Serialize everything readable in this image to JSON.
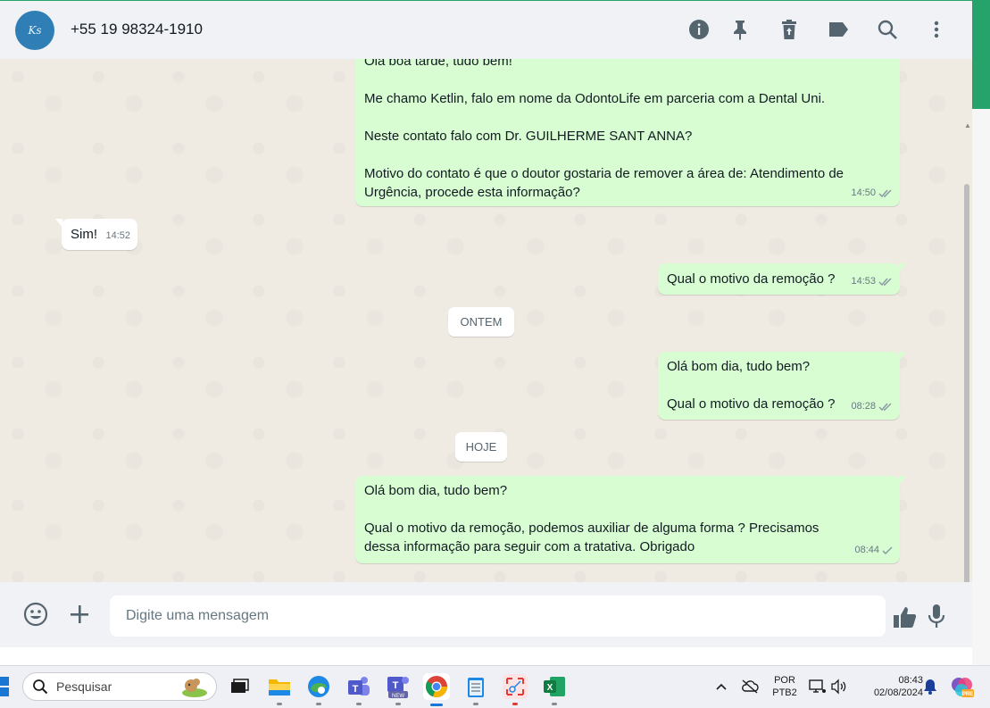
{
  "header": {
    "contact_name": "+55 19 98324-1910",
    "avatar_initials": "Ks",
    "icons": [
      "info-icon",
      "pin-icon",
      "delete-icon",
      "label-icon",
      "search-icon",
      "menu-icon"
    ]
  },
  "messages": [
    {
      "dir": "out",
      "text": "Olá boa tarde, tudo bem!\n\nMe chamo Ketlin, falo em nome da OdontoLife em parceria com a Dental Uni.\n\nNeste contato falo com Dr. GUILHERME SANT ANNA?\n\nMotivo do contato é que o doutor gostaria de remover a área de: Atendimento de Urgência, procede esta informação?",
      "time": "14:50",
      "status": "read"
    },
    {
      "dir": "in",
      "text": "Sim!",
      "time": "14:52"
    },
    {
      "dir": "out",
      "text": "Qual o motivo da remoção ?",
      "time": "14:53",
      "status": "read"
    },
    {
      "dir": "out",
      "text": "Olá bom dia, tudo bem?\n\nQual o motivo da remoção ?",
      "time": "08:28",
      "status": "read"
    },
    {
      "dir": "out",
      "text": "Olá bom dia, tudo bem?\n\nQual o motivo da remoção, podemos auxiliar de alguma forma ? Precisamos dessa informação para seguir com a tratativa. Obrigado",
      "time": "08:44",
      "status": "sent"
    }
  ],
  "dividers": {
    "yesterday": "ONTEM",
    "today": "HOJE"
  },
  "composer": {
    "placeholder": "Digite uma mensagem"
  },
  "taskbar": {
    "search_placeholder": "Pesquisar",
    "language": "POR",
    "layout": "PTB2",
    "time": "08:43",
    "date": "02/08/2024",
    "copilot_badge": "PRE",
    "teams_badge": "NEW"
  },
  "colors": {
    "outgoing_bubble": "#d9fdd3",
    "incoming_bubble": "#ffffff",
    "chat_background": "#efeae2",
    "read_ticks": "#53bdeb"
  }
}
